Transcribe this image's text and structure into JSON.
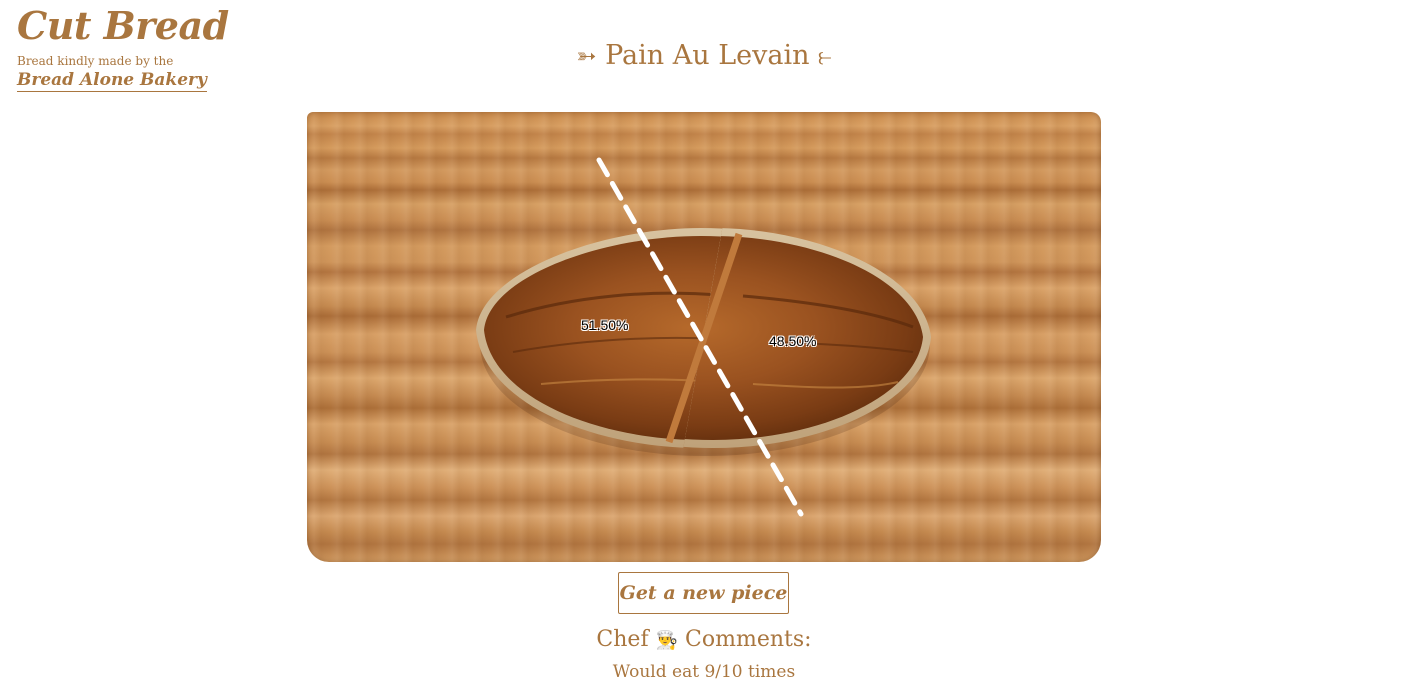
{
  "brand": {
    "title": "Cut Bread",
    "credit": "Bread kindly made by the",
    "link_label": "Bread Alone Bakery"
  },
  "heading": {
    "left_deco": "➳",
    "title": "Pain Au Levain",
    "right_deco": "⥼"
  },
  "cut": {
    "left_percent": "51.50%",
    "right_percent": "48.50%"
  },
  "actions": {
    "new_piece_label": "Get a new piece"
  },
  "comments": {
    "title_prefix": "Chef",
    "chef_icon": "👨‍🍳",
    "title_suffix": "Comments:",
    "text": "Would eat 9/10 times"
  },
  "colors": {
    "accent": "#a9763f",
    "board": "#c98a4c",
    "crust": "#8a4a1c"
  }
}
